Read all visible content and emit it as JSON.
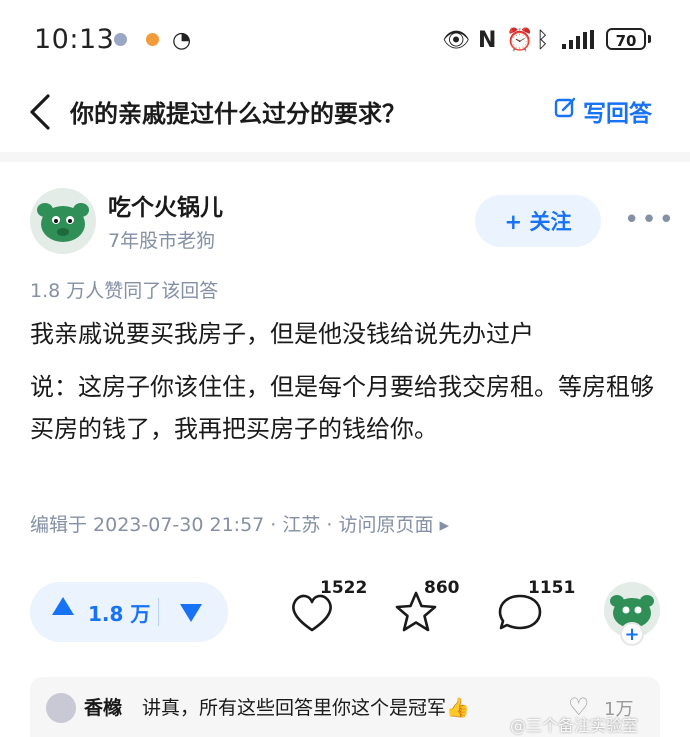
{
  "status_bar": {
    "time": "10:13",
    "battery": "70"
  },
  "nav": {
    "question_title": "你的亲戚提过什么过分的要求？",
    "write_answer_label": "写回答"
  },
  "author": {
    "name": "吃个火锅儿",
    "description": "7年股市老狗",
    "follow_label": "+ 关注"
  },
  "answer": {
    "agree_count_text": "1.8 万人赞同了该回答",
    "paragraphs": [
      "我亲戚说要买我房子，但是他没钱给说先办过户",
      "说：这房子你该住住，但是每个月要给我交房租。等房租够买房的钱了，我再把买房子的钱给你。"
    ],
    "meta": "编辑于 2023-07-30 21:57 · 江苏 · 访问原页面 ▸"
  },
  "actions": {
    "vote_count": "1.8 万",
    "like_count": "1522",
    "favorite_count": "860",
    "comment_count": "1151",
    "icons": [
      "heart-icon",
      "star-icon",
      "comment-icon"
    ]
  },
  "top_comment": {
    "name": "香橼",
    "text": "讲真，所有这些回答里你这个是冠军👍",
    "like_count": "1万"
  },
  "watermark": "@三个备注实验室",
  "colors": {
    "accent": "#1772f6",
    "muted": "#8590a6",
    "vote_bg": "#ebf3ff"
  }
}
